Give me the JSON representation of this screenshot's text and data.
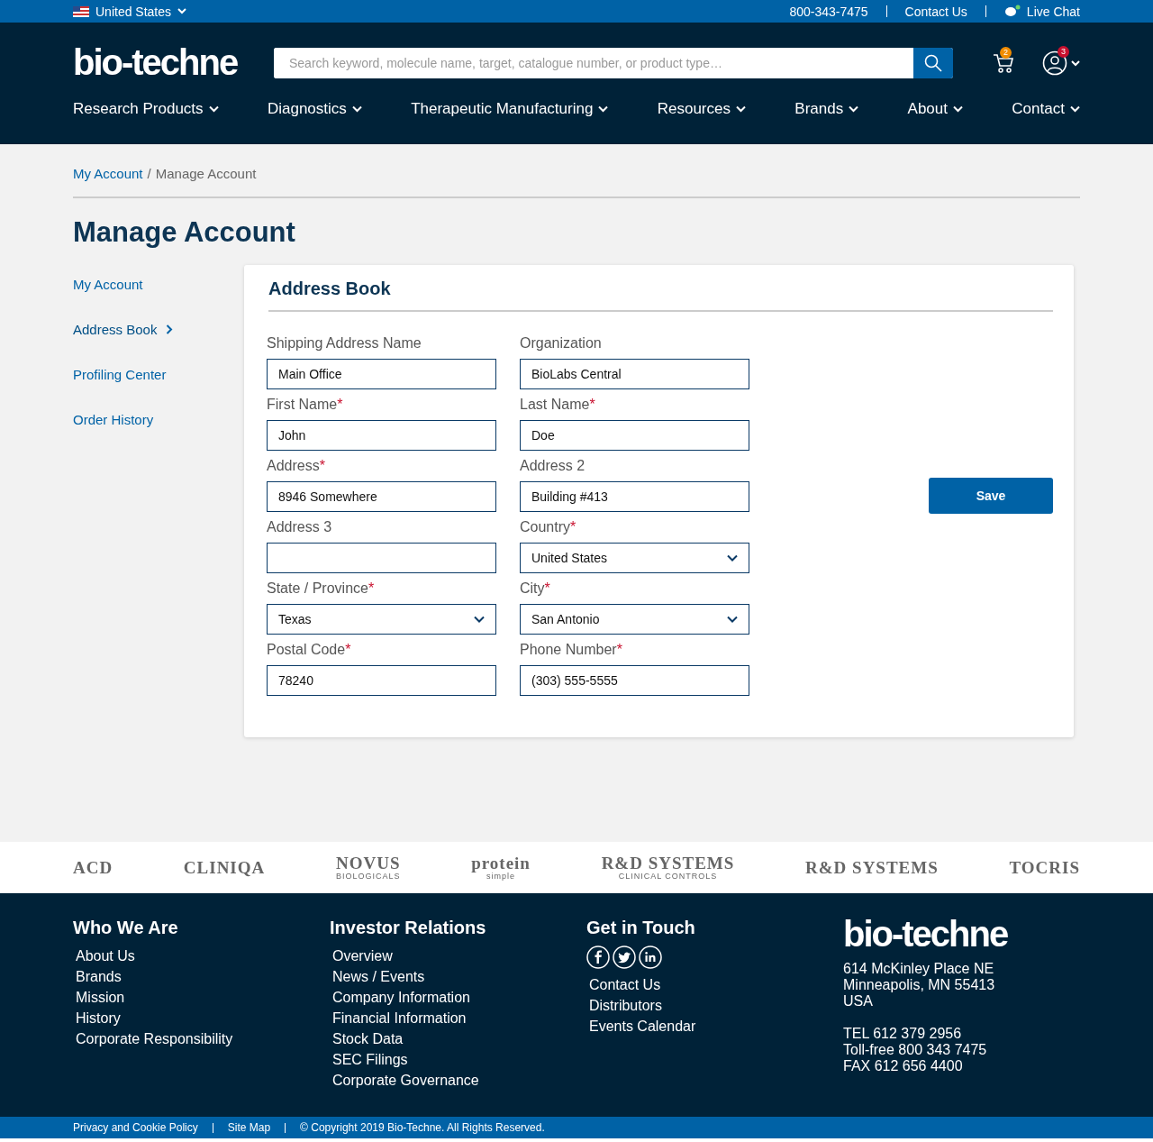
{
  "top_bar": {
    "country": "United States",
    "phone": "800-343-7475",
    "contact": "Contact Us",
    "chat": "Live Chat"
  },
  "header": {
    "logo": "bio-techne",
    "search": {
      "placeholder": "Search keyword, molecule name, target, catalogue number, or product type…"
    },
    "cart_count": "2",
    "account_count": "3"
  },
  "nav": [
    "Research Products",
    "Diagnostics",
    "Therapeutic Manufacturing",
    "Resources",
    "Brands",
    "About",
    "Contact"
  ],
  "breadcrumb": {
    "separator": "/",
    "items": [
      {
        "label": "My Account",
        "link": true
      },
      {
        "label": "Manage Account",
        "link": false
      }
    ]
  },
  "page_title": "Manage Account",
  "sidebar": {
    "items": [
      {
        "label": "My Account",
        "selected": false
      },
      {
        "label": "Address Book",
        "selected": true
      },
      {
        "label": "Profiling Center",
        "selected": false
      },
      {
        "label": "Order History",
        "selected": false
      }
    ]
  },
  "card": {
    "title": "Address Book",
    "save": "Save",
    "required_mark": "*",
    "fields": [
      {
        "label": "Shipping Address Name",
        "kind": "text",
        "required": false,
        "value": "Main Office"
      },
      {
        "label": "Organization",
        "kind": "text",
        "required": false,
        "value": "BioLabs Central"
      },
      {
        "label": "First Name",
        "kind": "text",
        "required": true,
        "value": "John"
      },
      {
        "label": "Last Name",
        "kind": "text",
        "required": true,
        "value": "Doe"
      },
      {
        "label": "Address",
        "kind": "text",
        "required": true,
        "value": "8946 Somewhere"
      },
      {
        "label": "Address 2",
        "kind": "text",
        "required": false,
        "value": "Building #413"
      },
      {
        "label": "Address 3",
        "kind": "text",
        "required": false
      },
      {
        "label": "Country",
        "kind": "select",
        "required": true,
        "value": "United States"
      },
      {
        "label": "State / Province",
        "kind": "select",
        "required": true,
        "value": "Texas"
      },
      {
        "label": "City",
        "kind": "select",
        "required": true,
        "value": "San Antonio"
      },
      {
        "label": "Postal Code",
        "kind": "text",
        "required": true,
        "value": "78240"
      },
      {
        "label": "Phone Number",
        "kind": "text",
        "required": true,
        "value": "(303) 555-5555"
      }
    ]
  },
  "brands": [
    {
      "lines": [
        "ACD"
      ]
    },
    {
      "lines": [
        "CLINIQA"
      ]
    },
    {
      "lines": [
        "NOVUS",
        "BIOLOGICALS"
      ]
    },
    {
      "lines": [
        "protein",
        "simple"
      ]
    },
    {
      "lines": [
        "R&D SYSTEMS",
        "CLINICAL CONTROLS"
      ]
    },
    {
      "lines": [
        "R&D SYSTEMS"
      ]
    },
    {
      "lines": [
        "TOCRIS"
      ]
    }
  ],
  "footer": {
    "columns": [
      {
        "title": "Who We Are",
        "links": [
          "About Us",
          "Brands",
          "Mission",
          "History",
          "Corporate Responsibility"
        ]
      },
      {
        "title": "Investor Relations",
        "links": [
          "Overview",
          "News / Events",
          "Company Information",
          "Financial Information",
          "Stock Data",
          "SEC Filings",
          "Corporate Governance"
        ]
      },
      {
        "title": "Get in Touch",
        "social": [
          {
            "kind": "facebook"
          },
          {
            "kind": "twitter"
          },
          {
            "kind": "linkedin"
          }
        ],
        "links": [
          "Contact Us",
          "Distributors",
          "Events Calendar"
        ]
      }
    ],
    "logo": "bio-techne",
    "address": [
      "614 McKinley Place NE",
      "Minneapolis, MN 55413",
      "USA"
    ],
    "phones": [
      "TEL 612 379 2956",
      "Toll-free 800 343 7475",
      "FAX 612 656 4400"
    ]
  },
  "bottom_bar": {
    "links": [
      "Privacy and Cookie Policy",
      "Site Map"
    ],
    "copyright": "© Copyright 2019 Bio-Techne. All Rights Reserved."
  }
}
